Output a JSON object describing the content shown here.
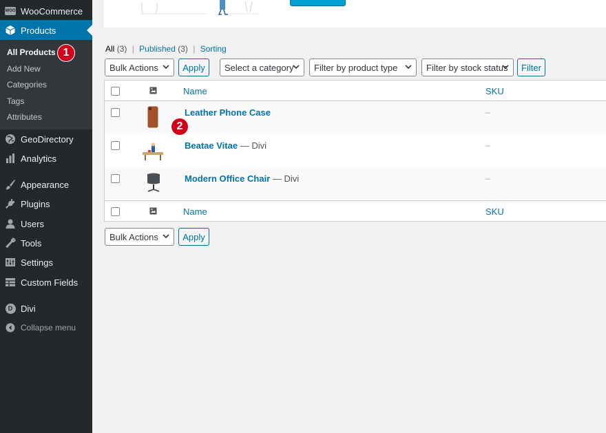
{
  "sidebar": {
    "top_item": "WooCommerce",
    "woo_badge": "WOO",
    "current_item": "Products",
    "submenu": [
      "All Products",
      "Add New",
      "Categories",
      "Tags",
      "Attributes"
    ],
    "items": [
      "GeoDirectory",
      "Analytics",
      "Appearance",
      "Plugins",
      "Users",
      "Tools",
      "Settings",
      "Custom Fields"
    ],
    "divi_badge": "D",
    "divi": "Divi",
    "collapse": "Collapse menu"
  },
  "markers": [
    "1",
    "2"
  ],
  "filters": {
    "all": "All",
    "all_count": "(3)",
    "published": "Published",
    "published_count": "(3)",
    "sorting": "Sorting",
    "separator": "|"
  },
  "controls": {
    "bulk_actions": "Bulk Actions",
    "apply": "Apply",
    "category": "Select a category",
    "product_type": "Filter by product type",
    "stock_status": "Filter by stock status",
    "filter": "Filter"
  },
  "table": {
    "columns": {
      "name": "Name",
      "sku": "SKU"
    },
    "rows": [
      {
        "name": "Leather Phone Case",
        "state": "",
        "sku": "–"
      },
      {
        "name": "Beatae Vitae",
        "state": " — Divi",
        "sku": "–"
      },
      {
        "name": "Modern Office Chair",
        "state": " — Divi",
        "sku": "–"
      }
    ]
  },
  "colors": {
    "sidebar_bg": "#23282d",
    "accent": "#0073aa",
    "marker": "#d0021b"
  }
}
